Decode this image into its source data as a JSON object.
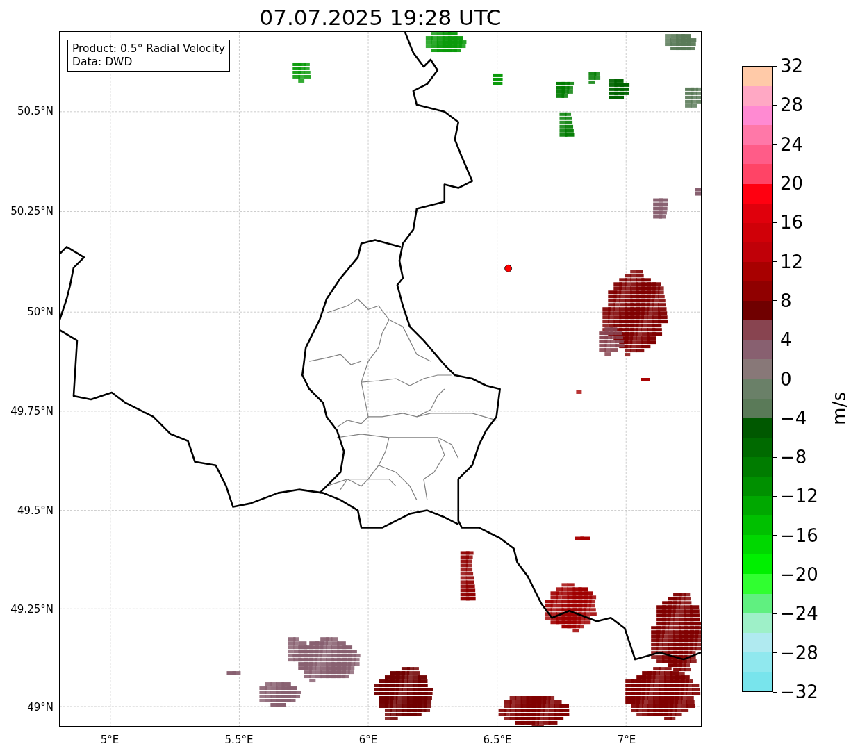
{
  "title": "07.07.2025 19:28 UTC",
  "info": [
    "Product: 0.5° Radial Velocity",
    "Data: DWD"
  ],
  "y_ticks": [
    "50.5°N",
    "50.25°N",
    "50°N",
    "49.75°N",
    "49.5°N",
    "49.25°N",
    "49°N"
  ],
  "x_ticks": [
    "5°E",
    "5.5°E",
    "6°E",
    "6.5°E",
    "7°E"
  ],
  "colorbar": {
    "label": "m/s",
    "ticks": [
      "32",
      "28",
      "24",
      "20",
      "16",
      "12",
      "8",
      "4",
      "0",
      "−4",
      "−8",
      "−12",
      "−16",
      "−20",
      "−24",
      "−28",
      "−32"
    ],
    "bands": [
      {
        "color": "#ffcaa8"
      },
      {
        "color": "#ffa8c4"
      },
      {
        "color": "#ff8ad2"
      },
      {
        "color": "#ff78a8"
      },
      {
        "color": "#ff5c88"
      },
      {
        "color": "#ff4466"
      },
      {
        "color": "#ff0010"
      },
      {
        "color": "#e0000c"
      },
      {
        "color": "#d00008"
      },
      {
        "color": "#c00008"
      },
      {
        "color": "#a80000"
      },
      {
        "color": "#900000"
      },
      {
        "color": "#700000"
      },
      {
        "color": "#884450"
      },
      {
        "color": "#886070"
      },
      {
        "color": "#887878"
      },
      {
        "color": "#6a8068"
      },
      {
        "color": "#5a7a58"
      },
      {
        "color": "#005800"
      },
      {
        "color": "#006a00"
      },
      {
        "color": "#007c00"
      },
      {
        "color": "#009000"
      },
      {
        "color": "#00a800"
      },
      {
        "color": "#00c000"
      },
      {
        "color": "#00d800"
      },
      {
        "color": "#00f000"
      },
      {
        "color": "#30ff30"
      },
      {
        "color": "#60f080"
      },
      {
        "color": "#9ef0c8"
      },
      {
        "color": "#b0eaf0"
      },
      {
        "color": "#90e8ee"
      },
      {
        "color": "#78e4ec"
      }
    ]
  }
}
